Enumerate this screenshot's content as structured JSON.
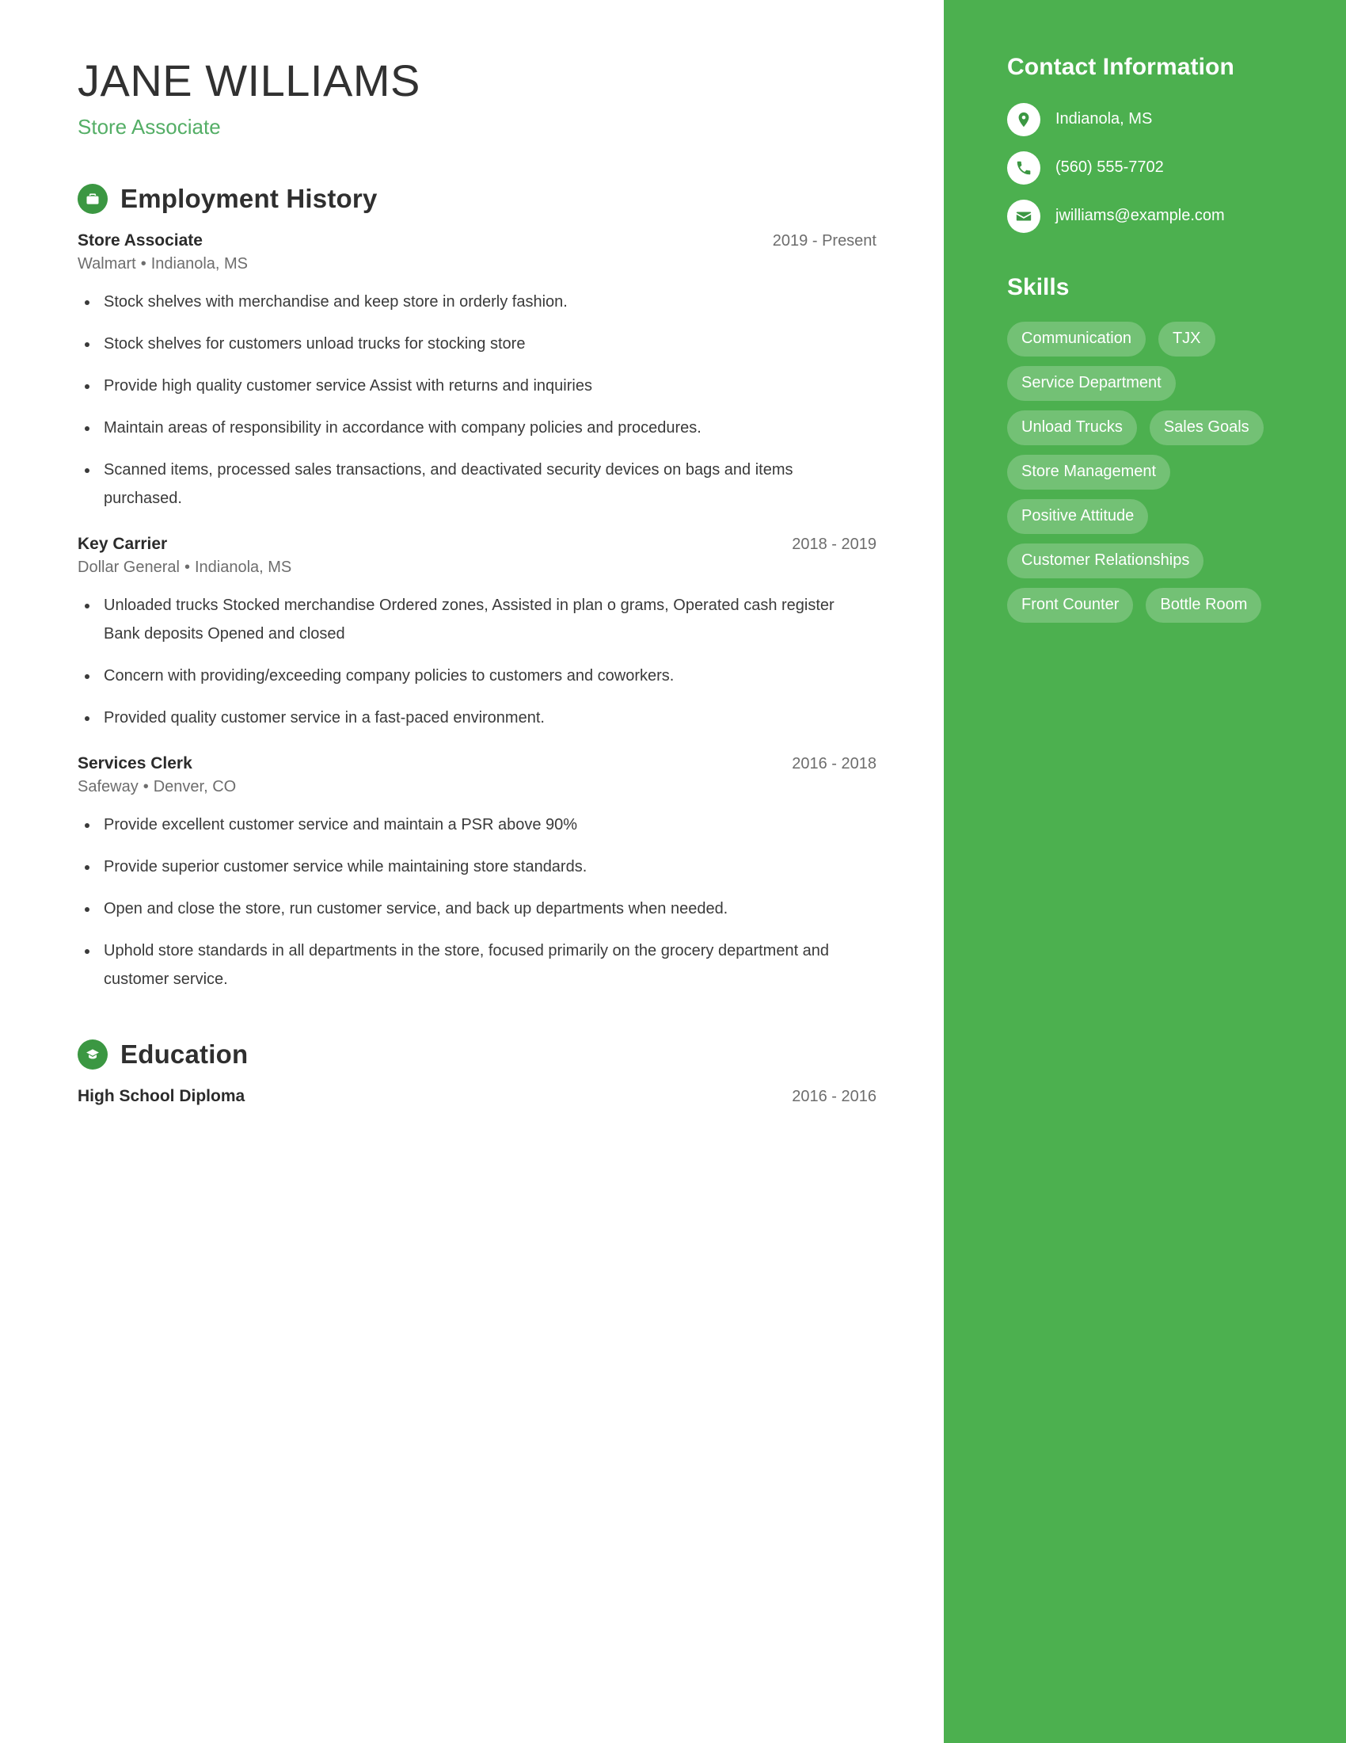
{
  "person": {
    "name": "JANE WILLIAMS",
    "title": "Store Associate"
  },
  "theme": {
    "sidebar_green": "#4CB04F",
    "accent_green": "#54AE66",
    "icon_green": "#3B9742",
    "heading_dark": "#2f2f2f",
    "body_gray": "#3a3a3a",
    "muted_gray": "#6d6d6d"
  },
  "sidebar": {
    "contact_heading": "Contact Information",
    "contact": [
      {
        "icon": "location-pin-icon",
        "value": "Indianola, MS"
      },
      {
        "icon": "phone-icon",
        "value": "(560) 555-7702"
      },
      {
        "icon": "email-icon",
        "value": "jwilliams@example.com"
      }
    ],
    "skills_heading": "Skills",
    "skills": [
      "Communication",
      "TJX",
      "Service Department",
      "Unload Trucks",
      "Sales Goals",
      "Store Management",
      "Positive Attitude",
      "Customer Relationships",
      "Front Counter",
      "Bottle Room"
    ]
  },
  "employment": {
    "heading": "Employment History",
    "icon": "briefcase-icon",
    "jobs": [
      {
        "role": "Store Associate",
        "dates": "2019 - Present",
        "company": "Walmart",
        "location": "Indianola, MS",
        "bullets": [
          "Stock shelves with merchandise and keep store in orderly fashion.",
          "Stock shelves for customers unload trucks for stocking store",
          "Provide high quality customer service Assist with returns and inquiries",
          "Maintain areas of responsibility in accordance with company policies and procedures.",
          "Scanned items, processed sales transactions, and deactivated security devices on bags and items purchased."
        ]
      },
      {
        "role": "Key Carrier",
        "dates": "2018 - 2019",
        "company": "Dollar General",
        "location": "Indianola, MS",
        "bullets": [
          "Unloaded trucks Stocked merchandise Ordered zones, Assisted in plan o grams, Operated cash register Bank deposits Opened and closed",
          "Concern with providing/exceeding company policies to customers and coworkers.",
          "Provided quality customer service in a fast-paced environment."
        ]
      },
      {
        "role": "Services Clerk",
        "dates": "2016 - 2018",
        "company": "Safeway",
        "location": "Denver, CO",
        "bullets": [
          "Provide excellent customer service and maintain a PSR above 90%",
          "Provide superior customer service while maintaining store standards.",
          "Open and close the store, run customer service, and back up departments when needed.",
          "Uphold store standards in all departments in the store, focused primarily on the grocery department and customer service."
        ]
      }
    ]
  },
  "education": {
    "heading": "Education",
    "icon": "graduation-cap-icon",
    "entries": [
      {
        "degree": "High School Diploma",
        "dates": "2016 - 2016"
      }
    ]
  }
}
